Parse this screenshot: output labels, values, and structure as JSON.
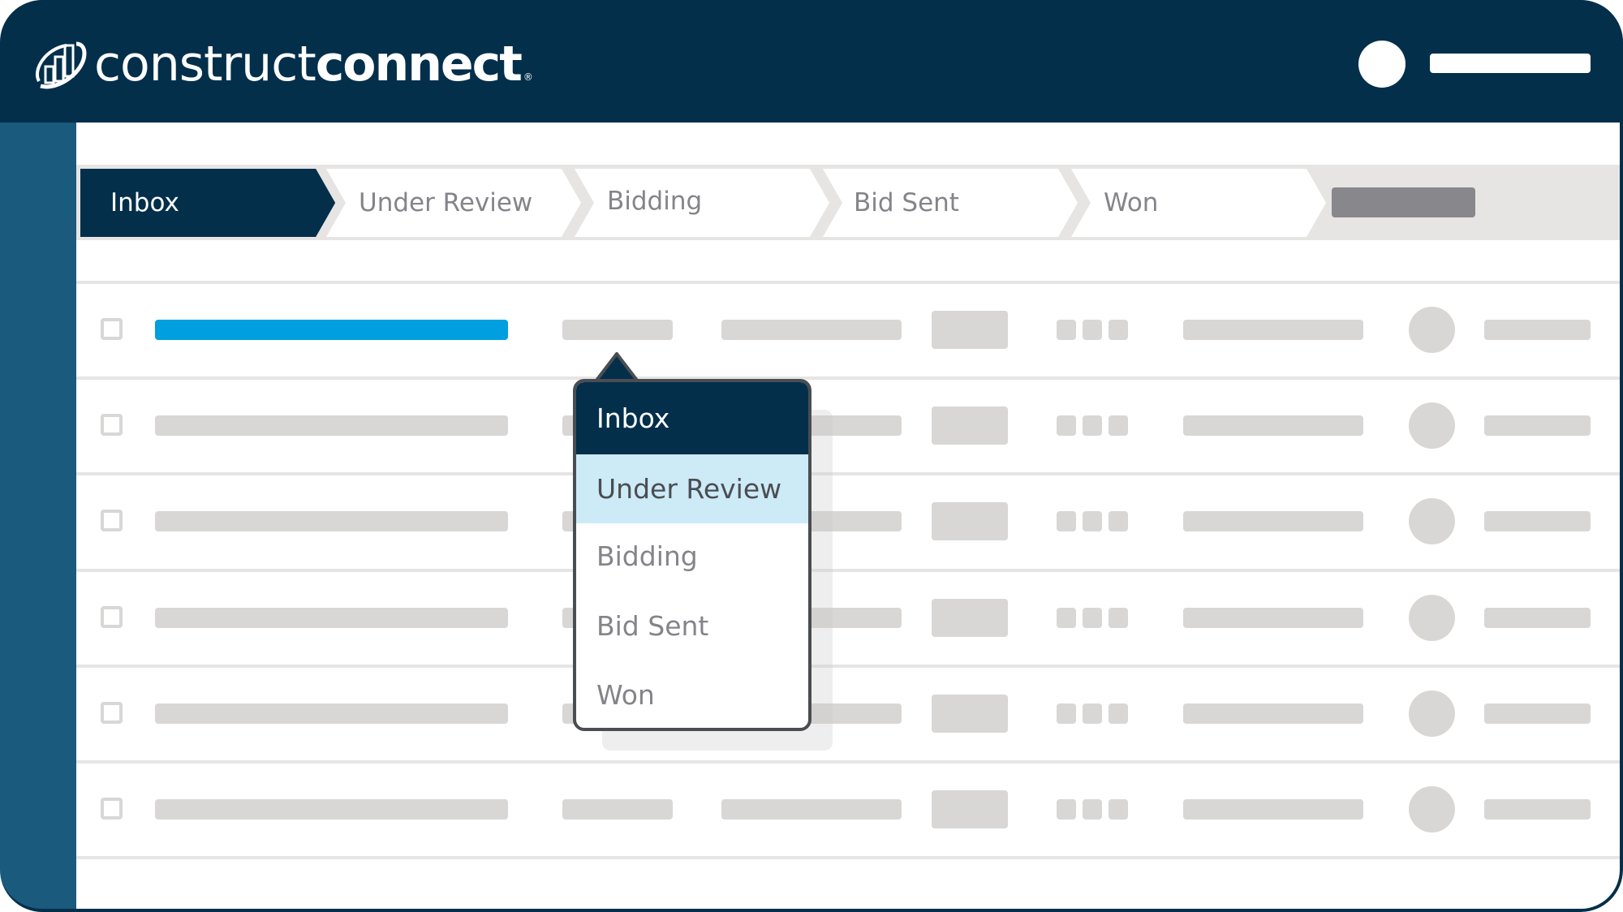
{
  "app": {
    "brand_light": "construct",
    "brand_bold": "connect",
    "brand_mark": "®",
    "colors": {
      "navy": "#032f4b",
      "sidebar": "#1a5a7c",
      "accent_blue": "#009fe0",
      "highlight": "#cdeaf7",
      "placeholder": "#d8d7d6"
    }
  },
  "header": {
    "avatar_icon": "user-avatar-placeholder",
    "user_name_placeholder": ""
  },
  "pipeline": {
    "tabs": [
      {
        "label": "Inbox",
        "active": true
      },
      {
        "label": "Under Review",
        "active": false
      },
      {
        "label": "Bidding",
        "active": false
      },
      {
        "label": "Bid Sent",
        "active": false
      },
      {
        "label": "Won",
        "active": false
      }
    ],
    "action_buttons": [
      "",
      ""
    ]
  },
  "table": {
    "row_count": 6,
    "selected_row_index": 0
  },
  "status_dropdown": {
    "current": "Inbox",
    "hovered": "Under Review",
    "options": [
      "Inbox",
      "Under Review",
      "Bidding",
      "Bid Sent",
      "Won"
    ]
  }
}
